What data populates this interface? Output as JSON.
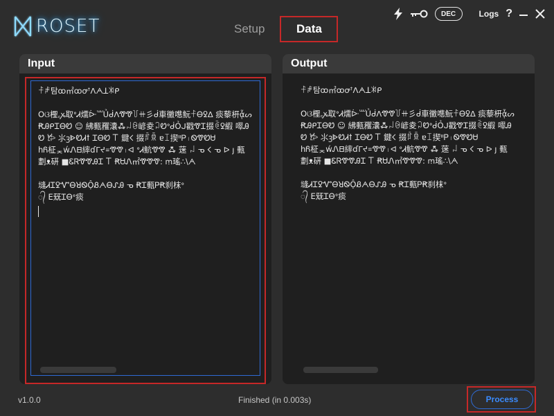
{
  "app": {
    "logo_text": "ROSET"
  },
  "tabs": [
    {
      "label": "Setup",
      "active": false
    },
    {
      "label": "Data",
      "active": true
    }
  ],
  "topbar": {
    "lightning_icon": "lightning-icon",
    "key_icon": "key-icon",
    "dec_label": "DEC",
    "logs_label": "Logs",
    "help_label": "?",
    "close_label": "✕"
  },
  "input": {
    "title": "Input",
    "text": "ꊰꆫ탐ꝏ㎡ꝏꝍꜛᐱᗅꓕꐒᑭ\n\nOଓ檉꜀ꭘ取ᐤᏗ燸ᐕ꒶ỦᑰᐱᏡᏡ꒦ꔠ彡ᑰ車黴㗹魭ꊰᎾꝿᐃ 痰藜枅ᾆᔕꞦᎯᑭᏆᎾᏬ ☺ 紼甀矡灢ꗈ꒖ꆩ嵃夌꒜ᏬᐤᑰỎᒍ戳ᏡᏆ掇ꏱꝿ縀 噿꫒ᎯᏬ 𐂂 ⺢ꝫᐈᏬᏗꝉ ᏆᎾᏬ 𐊗 鍵𐌂 掇ꑈꌊ ɐꀤ揳ᐦᏢ꤯ᏫᏡᏬᏌ\nhᏲ柾ᆽẃᏁ𐊧繂ɗᒥᔪ꓿ᏡᏡ꤯ᐊ ᐤᏗ魧ᏡᏡ ꗈ 蒾 ꒖ ᓀ 𐌂 ᓀ ᐅ ȷ 甀\n劃ᴥ硏 ■ᏋᏒᏡᏡᎯᏆ 𐊗 ꞦᏌᏁ㎡ᏡᏡᏡ: ꭑ瑤∴\\ᗅ\n\n塳ᏗᏆꝿᏉᎾꓤᏫỘᏰᗅᎾᔑᎯ ᓀ ꞦᏆ甀ᏢꞦ刹枺ᐤ\n᭄ ⴹ兓ᏆᎾᐤ痰",
    "text_short": "ꊰꆫ탐ꝏ㎡ꝏꝍꜛᐱᗅ꓿ꐒᑭ"
  },
  "output": {
    "title": "Output",
    "text": "ꊰꆫ탐ꝏ㎡ꝏꝍꜛᐱᗅꓕꐒᑭ\n\nOଓ檉꜀ꭘ取ᐤᏗ燸ᐕ꒶ỦᑰᐱᏡᏡ꒦ꔠ彡ᑰ車黴㗹魭ꊰᎾꝿᐃ 痰藜枅ᾆᔕꞦᎯᑭᏆᎾᏬ ☺ 紼甀矡灢ꗈ꒖ꆩ嵃夌꒜ᏬᐤᑰỎᒍ戳ᏡᏆ掇ꏱꝿ縀 噿꫒ᎯᏬ 𐂂 ⺢ꝫᐈᏬᏗꝉ ᏆᎾᏬ 𐊗 鍵𐌂 掇ꑈꌊ ɐꀤ揳ᐦᏢ꤯ᏫᏡᏬᏌ\nhᏲ柾ᆽẃᏁ𐊧繂ɗᒥᔪ꓿ᏡᏡ꤯ᐊ ᐤᏗ魧ᏡᏡ ꗈ 蒾 ꒖ ᓀ 𐌂 ᓀ ᐅ ȷ 甀\n劃ᴥ硏 ■ᏋᏒᏡᏡᎯᏆ 𐊗 ꞦᏌᏁ㎡ᏡᏡᏡ: ꭑ瑤∴\\ᗅ\n\n塳ᏗᏆꝿᏉᎾꓤᏫỘᏰᗅᎾᔑᎯ ᓀ ꞦᏆ甀ᏢꞦ刹枺ᐤ\n᭄ ⴹ兓ᏆᎾᐤ痰"
  },
  "footer": {
    "version": "v1.0.0",
    "status": "Finished (in 0.003s)",
    "process_label": "Process"
  },
  "colors": {
    "background": "#2d2d2d",
    "panel": "#1f1f1f",
    "panel_header": "#3a3a3a",
    "accent_blue": "#2f6bd6",
    "highlight_red": "#c62828",
    "logo_glow": "#3db9ff"
  }
}
